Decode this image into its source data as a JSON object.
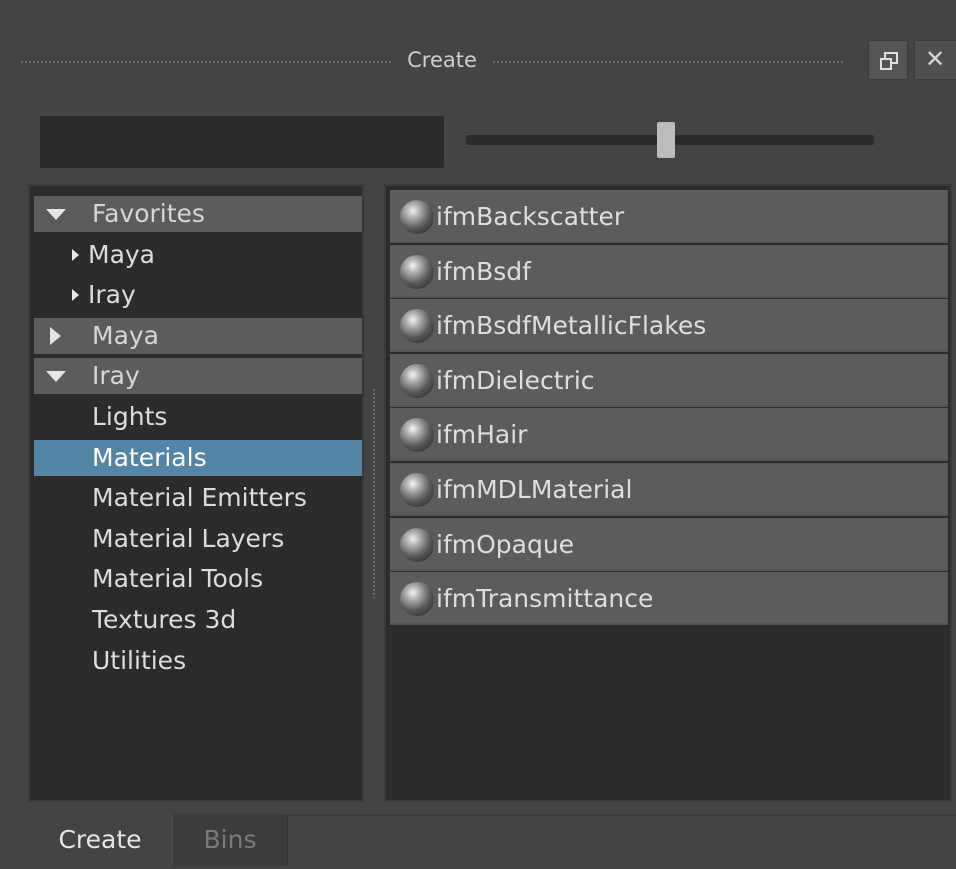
{
  "window": {
    "title": "Create",
    "float_icon": "restore-window-icon",
    "close_icon": "close-icon",
    "close_glyph": "✕"
  },
  "filter": {
    "value": ""
  },
  "size_slider": {
    "level": 0.49
  },
  "tree": {
    "items": [
      {
        "label": "Favorites",
        "kind": "header",
        "expanded": true
      },
      {
        "label": "Maya",
        "kind": "child-collapsed"
      },
      {
        "label": "Iray",
        "kind": "child-collapsed"
      },
      {
        "label": "Maya",
        "kind": "header",
        "expanded": false
      },
      {
        "label": "Iray",
        "kind": "header",
        "expanded": true
      },
      {
        "label": "Lights",
        "kind": "leaf"
      },
      {
        "label": "Materials",
        "kind": "leaf",
        "selected": true
      },
      {
        "label": "Material Emitters",
        "kind": "leaf"
      },
      {
        "label": "Material Layers",
        "kind": "leaf"
      },
      {
        "label": "Material Tools",
        "kind": "leaf"
      },
      {
        "label": "Textures 3d",
        "kind": "leaf"
      },
      {
        "label": "Utilities",
        "kind": "leaf"
      }
    ]
  },
  "list": {
    "item_icon": "material-sphere-icon",
    "items": [
      "ifmBackscatter",
      "ifmBsdf",
      "ifmBsdfMetallicFlakes",
      "ifmDielectric",
      "ifmHair",
      "ifmMDLMaterial",
      "ifmOpaque",
      "ifmTransmittance"
    ]
  },
  "tabs": [
    {
      "label": "Create",
      "active": true
    },
    {
      "label": "Bins",
      "active": false
    }
  ],
  "colors": {
    "selection": "#5285a6",
    "panel_bg": "#2b2b2b",
    "window_bg": "#444444"
  }
}
